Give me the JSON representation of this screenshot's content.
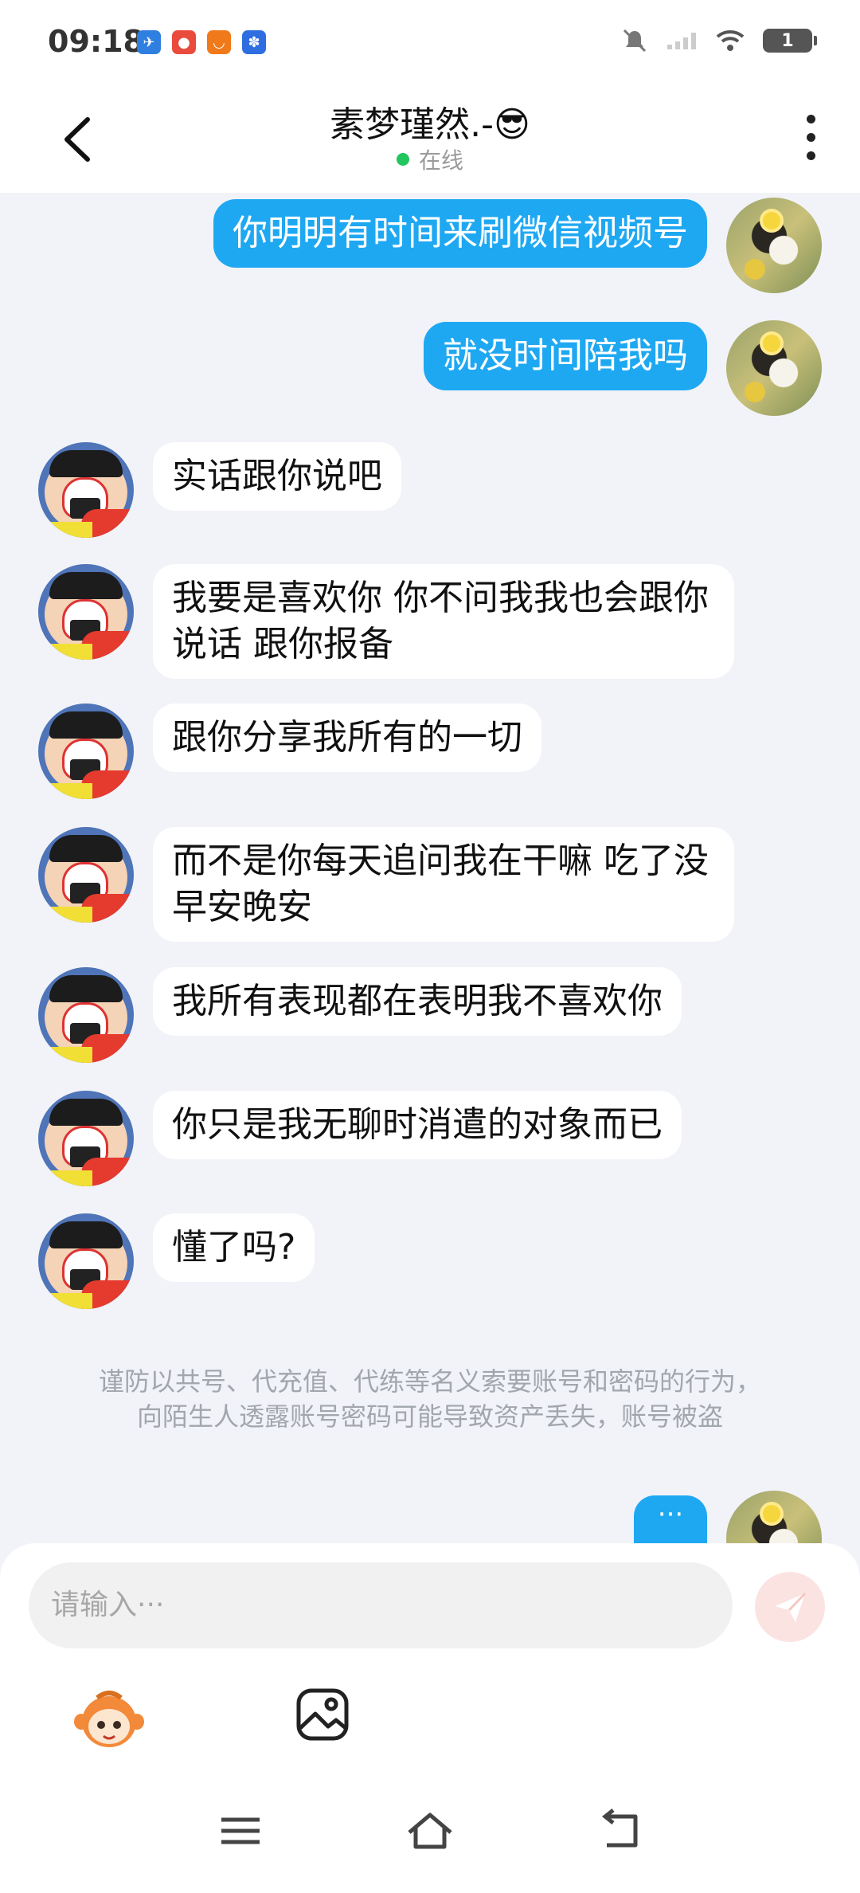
{
  "status_bar": {
    "time": "09:18",
    "battery": "1"
  },
  "header": {
    "title": "素梦瑾然.-😎",
    "status": "在线"
  },
  "messages": [
    {
      "side": "out",
      "text": "你明明有时间来刷微信视频号"
    },
    {
      "side": "out",
      "text": "就没时间陪我吗"
    },
    {
      "side": "in",
      "text": "实话跟你说吧"
    },
    {
      "side": "in",
      "text": "我要是喜欢你 你不问我我也会跟你说话 跟你报备"
    },
    {
      "side": "in",
      "text": "跟你分享我所有的一切"
    },
    {
      "side": "in",
      "text": "而不是你每天追问我在干嘛 吃了没 早安晚安"
    },
    {
      "side": "in",
      "text": "我所有表现都在表明我不喜欢你"
    },
    {
      "side": "in",
      "text": "你只是我无聊时消遣的对象而已"
    },
    {
      "side": "in",
      "text": "懂了吗?"
    }
  ],
  "notice": {
    "line1": "谨防以共号、代充值、代练等名义索要账号和密码的行为，",
    "line2": "向陌生人透露账号密码可能导致资产丢失，账号被盗"
  },
  "typing_indicator": "···",
  "input": {
    "placeholder": "请输入···"
  },
  "colors": {
    "outgoing_bubble": "#1fa8f2",
    "incoming_bubble": "#ffffff",
    "chat_background": "#f1f3f8",
    "online_dot": "#22c55e",
    "send_button": "#fbe3e1"
  }
}
